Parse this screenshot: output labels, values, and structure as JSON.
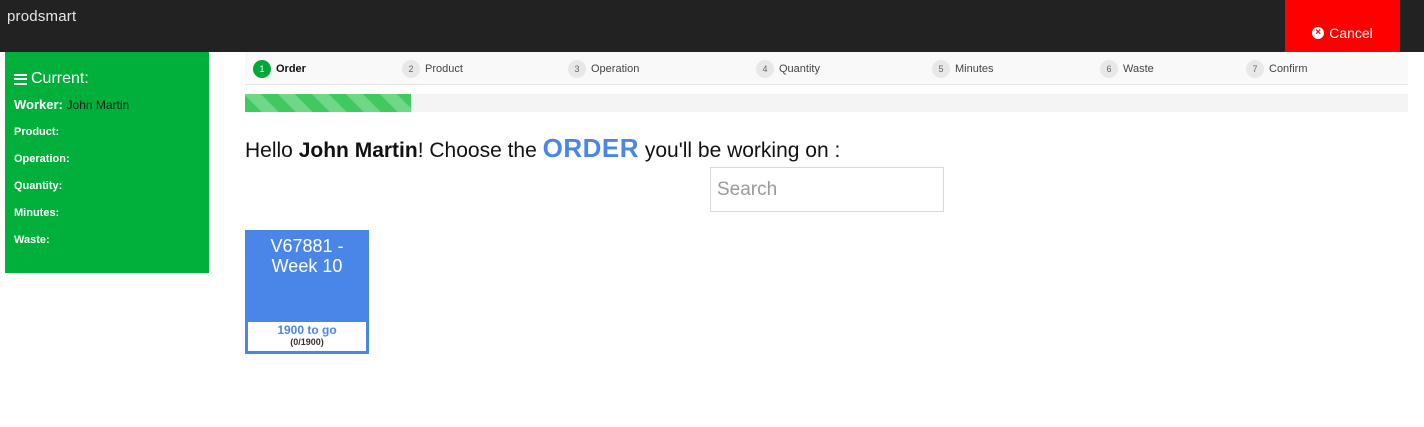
{
  "app": {
    "brand": "prodsmart"
  },
  "header": {
    "cancel_label": "Cancel",
    "cancel_icon": "times-circle-icon"
  },
  "sidebar": {
    "title": "Current:",
    "worker_label": "Worker:",
    "worker_value": "John Martin",
    "fields": [
      "Product:",
      "Operation:",
      "Quantity:",
      "Minutes:",
      "Waste:"
    ]
  },
  "steps": [
    {
      "num": "1",
      "label": "Order",
      "active": true
    },
    {
      "num": "2",
      "label": "Product",
      "active": false
    },
    {
      "num": "3",
      "label": "Operation",
      "active": false
    },
    {
      "num": "4",
      "label": "Quantity",
      "active": false
    },
    {
      "num": "5",
      "label": "Minutes",
      "active": false
    },
    {
      "num": "6",
      "label": "Waste",
      "active": false
    },
    {
      "num": "7",
      "label": "Confirm",
      "active": false
    }
  ],
  "progress": {
    "fraction": 0.143,
    "color": "#3fc95f"
  },
  "prompt": {
    "prefix": "Hello ",
    "name": "John Martin",
    "middle": "! Choose the ",
    "keyword": "ORDER",
    "suffix": " you'll be working on :"
  },
  "search": {
    "placeholder": "Search",
    "value": ""
  },
  "orders": [
    {
      "title": "V67881 - Week 10",
      "to_go": "1900 to go",
      "count": "(0/1900)"
    }
  ],
  "colors": {
    "brand_green": "#00b03a",
    "accent_blue": "#4a86e8",
    "cancel_red": "#ff0000",
    "topbar": "#222222"
  }
}
